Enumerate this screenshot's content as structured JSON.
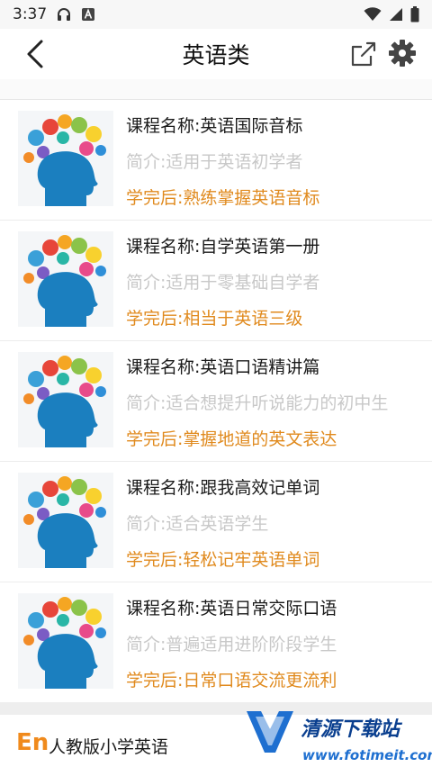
{
  "status_bar": {
    "time": "3:37",
    "icons": [
      "headphones-icon",
      "a-badge-icon",
      "wifi-icon",
      "signal-icon",
      "battery-icon"
    ]
  },
  "nav": {
    "title": "英语类",
    "back_icon": "chevron-left-icon",
    "share_icon": "share-icon",
    "settings_icon": "gear-icon"
  },
  "courses": [
    {
      "name": "课程名称:英语国际音标",
      "intro": "简介:适用于英语初学者",
      "result": "学完后:熟练掌握英语音标"
    },
    {
      "name": "课程名称:自学英语第一册",
      "intro": "简介:适用于零基础自学者",
      "result": "学完后:相当于英语三级"
    },
    {
      "name": "课程名称:英语口语精讲篇",
      "intro": "简介:适合想提升听说能力的初中生",
      "result": "学完后:掌握地道的英文表达"
    },
    {
      "name": "课程名称:跟我高效记单词",
      "intro": "简介:适合英语学生",
      "result": "学完后:轻松记牢英语单词"
    },
    {
      "name": "课程名称:英语日常交际口语",
      "intro": "简介:普遍适用进阶阶段学生",
      "result": "学完后:日常口语交流更流利"
    }
  ],
  "bottom": {
    "logo": "En",
    "label": "人教版小学英语"
  },
  "watermark": {
    "text": "清源下载站",
    "url": "www.fotimeit.com"
  },
  "colors": {
    "accent": "#e08a1e",
    "intro_text": "#c8c8c8",
    "head": "#1b7fbf"
  }
}
